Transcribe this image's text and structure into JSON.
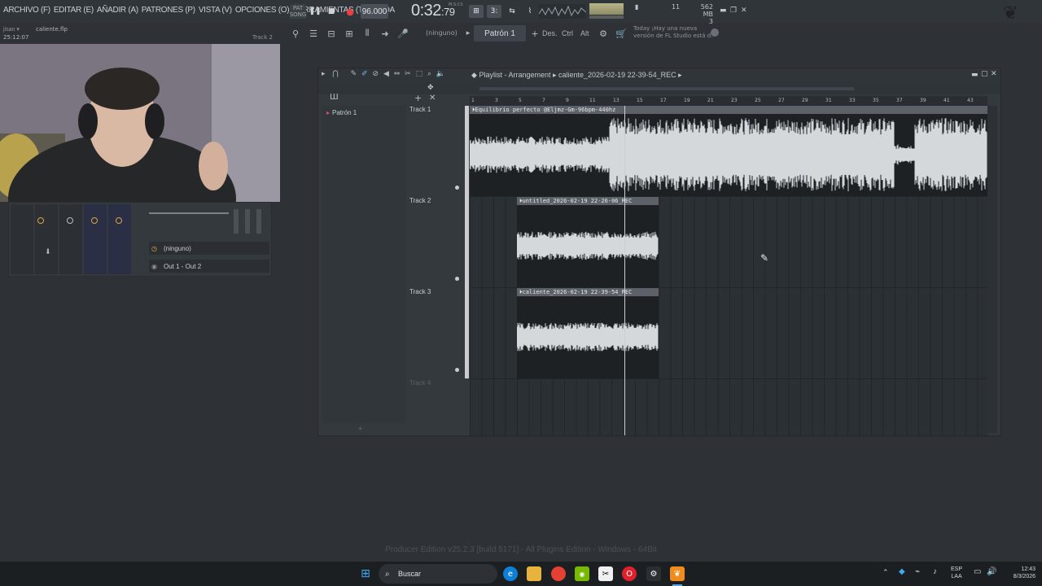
{
  "menu": [
    "ARCHIVO (F)",
    "EDITAR (E)",
    "AÑADIR (A)",
    "PATRONES (P)",
    "VISTA (V)",
    "OPCIONES (O)",
    "HERRAMIENTAS (T)",
    "AYUDA"
  ],
  "transport": {
    "song_label": "SONG",
    "tempo": "96.000",
    "time_main": "0:32",
    "time_sub": ":79",
    "time_unit": "M:S:CS"
  },
  "perf": {
    "poly": "11",
    "mem": "562 MB",
    "cpu_count": "3"
  },
  "toolbar2": {
    "ninguno": "(ninguno)",
    "pattern": "Patrón 1",
    "des": "Des.",
    "ctrl": "Ctrl",
    "alt": "Alt"
  },
  "news": {
    "line1": "Today ¡Hay una nueva",
    "line2": "versión de FL Studio está d."
  },
  "hint": {
    "user": "jisan",
    "file": "caliente.flp",
    "clock": "25:12:07",
    "track": "Track 2"
  },
  "mixer": {
    "slot1": "(ninguno)",
    "slot2": "Out 1 - Out 2"
  },
  "playlist": {
    "title": "Playlist - Arrangement",
    "song": "caliente_2026-02-19 22-39-54_REC",
    "pattern": "Patrón 1",
    "ruler": [
      "1",
      "3",
      "5",
      "7",
      "9",
      "11",
      "13",
      "15",
      "17",
      "19",
      "21",
      "23",
      "25",
      "27",
      "29",
      "31",
      "33",
      "35",
      "37",
      "39",
      "41",
      "43"
    ],
    "tracks": [
      "Track 1",
      "Track 2",
      "Track 3",
      "Track 4"
    ],
    "clips": [
      {
        "name": "Equilibrio perfecto @Eljmz-Gm-96bpm-440hz"
      },
      {
        "name": "untitled_2026-02-19 22-26-06_REC"
      },
      {
        "name": "caliente_2026-02-19 22-39-54_REC"
      }
    ]
  },
  "footer": "Producer Edition v25.2.3 [build 5171] - All Plugins Edition - Windows - 64Bit",
  "taskbar": {
    "search": "Buscar",
    "lang1": "ESP",
    "lang2": "LAA",
    "time": "12:43",
    "date": "8/3/2026"
  }
}
